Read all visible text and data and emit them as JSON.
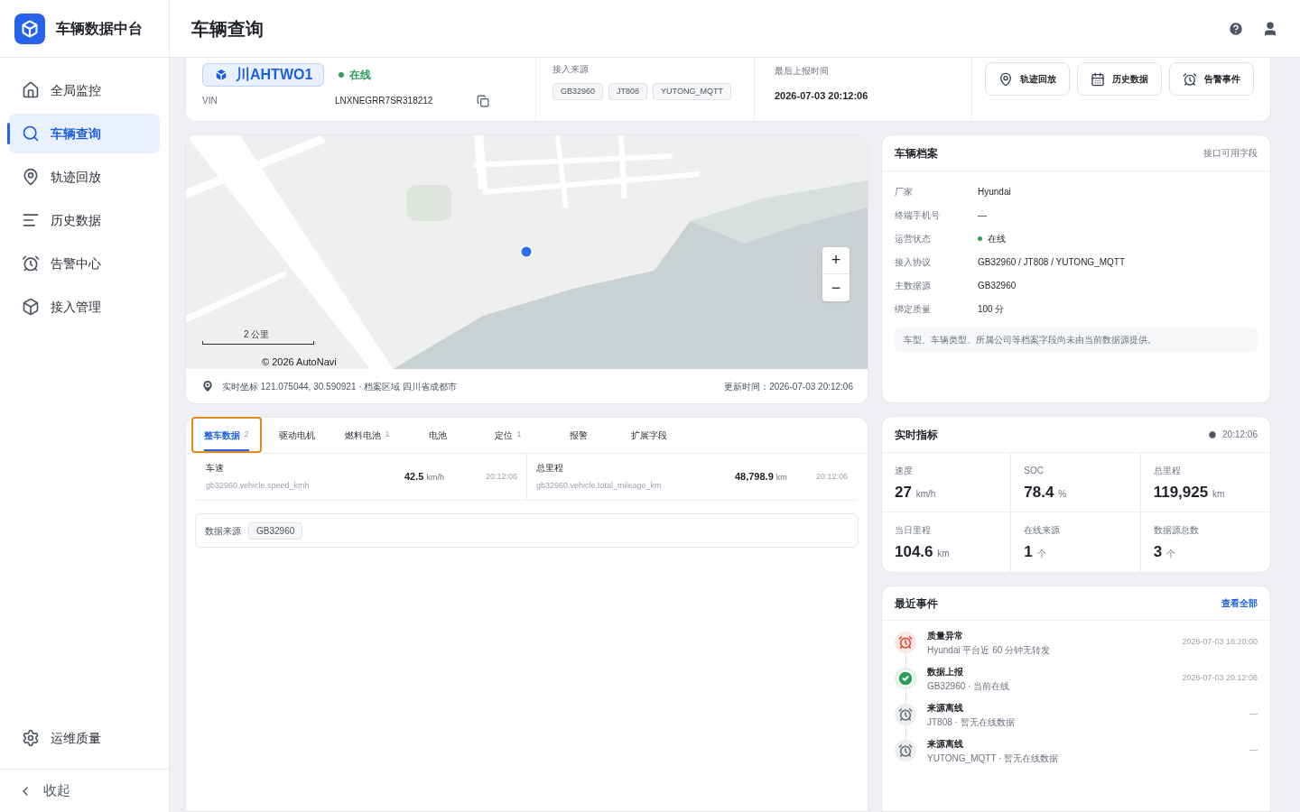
{
  "app": {
    "name": "车辆数据中台"
  },
  "sidebar": {
    "items": [
      {
        "label": "全局监控",
        "selected": false
      },
      {
        "label": "车辆查询",
        "selected": true
      },
      {
        "label": "轨迹回放",
        "selected": false
      },
      {
        "label": "历史数据",
        "selected": false
      },
      {
        "label": "告警中心",
        "selected": false
      },
      {
        "label": "接入管理",
        "selected": false
      }
    ],
    "bottom_item": {
      "label": "运维质量"
    },
    "collapse": {
      "label": "收起"
    }
  },
  "header": {
    "title": "车辆查询"
  },
  "vehicle": {
    "plate": "川AHTWO1",
    "status": "在线",
    "online": true,
    "vin_label": "VIN",
    "vin": "LNXNEGRR7SR318212",
    "sources_label": "接入来源",
    "sources": [
      "GB32960",
      "JT808",
      "YUTONG_MQTT"
    ],
    "last_report_label": "最后上报时间",
    "last_report": "2026-07-03 20:12:06",
    "actions": [
      {
        "label": "轨迹回放"
      },
      {
        "label": "历史数据"
      },
      {
        "label": "告警事件"
      }
    ]
  },
  "map": {
    "scale": "2 公里",
    "attribution": "© 2026 AutoNavi",
    "zoom_in": "+",
    "zoom_out": "−",
    "coords": "实时坐标 121.075044, 30.590921 · 档案区域 四川省成都市",
    "updated": "更新时间：2026-07-03 20:12:06"
  },
  "data_tabs": [
    {
      "label": "整车数据",
      "count": "2",
      "selected": true,
      "focused": true
    },
    {
      "label": "驱动电机",
      "selected": false,
      "focused": false
    },
    {
      "label": "燃料电池",
      "count": "1",
      "selected": false,
      "focused": false
    },
    {
      "label": "电池",
      "selected": false,
      "focused": false
    },
    {
      "label": "定位",
      "count": "1",
      "selected": false,
      "focused": false
    },
    {
      "label": "报警",
      "selected": false,
      "focused": false
    },
    {
      "label": "扩展字段",
      "selected": false,
      "focused": false
    }
  ],
  "fields": [
    {
      "name": "车速",
      "key": "gb32960.vehicle.speed_kmh",
      "value": "42.5",
      "unit": "km/h",
      "time": "20:12:06"
    },
    {
      "name": "总里程",
      "key": "gb32960.vehicle.total_mileage_km",
      "value": "48,798.9",
      "unit": "km",
      "time": "20:12:06"
    }
  ],
  "data_source": {
    "label": "数据来源",
    "value": "GB32960"
  },
  "archive": {
    "title": "车辆档案",
    "hint": "接口可用字段",
    "rows": [
      {
        "label": "厂家",
        "value": "Hyundai"
      },
      {
        "label": "终端手机号",
        "value": "—"
      },
      {
        "label": "运营状态",
        "value": "在线",
        "kind": "status",
        "color": "#2f9e5b"
      },
      {
        "label": "接入协议",
        "value": "GB32960 / JT808 / YUTONG_MQTT"
      },
      {
        "label": "主数据源",
        "value": "GB32960"
      },
      {
        "label": "绑定质量",
        "value": "100 分"
      }
    ],
    "note": "车型、车辆类型、所属公司等档案字段尚未由当前数据源提供。"
  },
  "metrics": {
    "title": "实时指标",
    "time": "20:12:06",
    "items": [
      {
        "label": "速度",
        "value": "27",
        "unit": "km/h"
      },
      {
        "label": "SOC",
        "value": "78.4",
        "unit": "%"
      },
      {
        "label": "总里程",
        "value": "119,925",
        "unit": "km"
      },
      {
        "label": "当日里程",
        "value": "104.6",
        "unit": "km"
      },
      {
        "label": "在线来源",
        "value": "1",
        "unit": "个"
      },
      {
        "label": "数据源总数",
        "value": "3",
        "unit": "个"
      }
    ]
  },
  "events": {
    "title": "最近事件",
    "link": "查看全部",
    "items": [
      {
        "kind": "alert",
        "title": "质量异常",
        "detail": "Hyundai 平台近 60 分钟无转发",
        "time": "2026-07-03 18:20:00"
      },
      {
        "kind": "success",
        "title": "数据上报",
        "detail": "GB32960 · 当前在线",
        "time": "2026-07-03 20:12:06"
      },
      {
        "kind": "offline",
        "title": "来源离线",
        "detail": "JT808 · 暂无在线数据",
        "time": "—"
      },
      {
        "kind": "offline",
        "title": "来源离线",
        "detail": "YUTONG_MQTT · 暂无在线数据",
        "time": "—"
      }
    ]
  }
}
